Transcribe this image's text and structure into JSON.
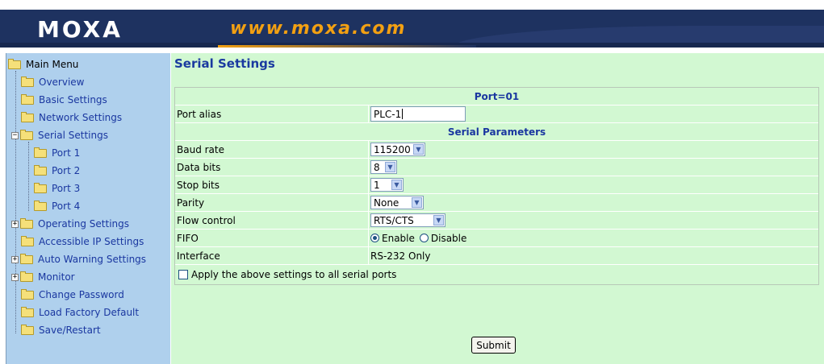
{
  "header": {
    "logo": "MOXA",
    "url": "www.moxa.com"
  },
  "sidebar": {
    "root": "Main Menu",
    "items": [
      {
        "label": "Overview"
      },
      {
        "label": "Basic Settings"
      },
      {
        "label": "Network Settings"
      },
      {
        "label": "Serial Settings"
      },
      {
        "label": "Port 1"
      },
      {
        "label": "Port 2"
      },
      {
        "label": "Port 3"
      },
      {
        "label": "Port 4"
      },
      {
        "label": "Operating Settings"
      },
      {
        "label": "Accessible IP Settings"
      },
      {
        "label": "Auto Warning Settings"
      },
      {
        "label": "Monitor"
      },
      {
        "label": "Change Password"
      },
      {
        "label": "Load Factory Default"
      },
      {
        "label": "Save/Restart"
      }
    ]
  },
  "main": {
    "title": "Serial Settings",
    "port_header": "Port=01",
    "port_alias_label": "Port alias",
    "port_alias_value": "PLC-1",
    "serial_params_header": "Serial Parameters",
    "baud_rate_label": "Baud rate",
    "baud_rate_value": "115200",
    "data_bits_label": "Data bits",
    "data_bits_value": "8",
    "stop_bits_label": "Stop bits",
    "stop_bits_value": "1",
    "parity_label": "Parity",
    "parity_value": "None",
    "flow_control_label": "Flow control",
    "flow_control_value": "RTS/CTS",
    "fifo_label": "FIFO",
    "fifo_enable": "Enable",
    "fifo_disable": "Disable",
    "interface_label": "Interface",
    "interface_value": "RS-232 Only",
    "apply_all_label": "Apply the above settings to all serial ports",
    "submit_label": "Submit"
  },
  "colors": {
    "header_bg": "#1e3260",
    "url_text": "#f2a012",
    "sidebar_bg": "#afd0ed",
    "main_bg": "#d2f8d2",
    "link_text": "#1a37a0"
  }
}
